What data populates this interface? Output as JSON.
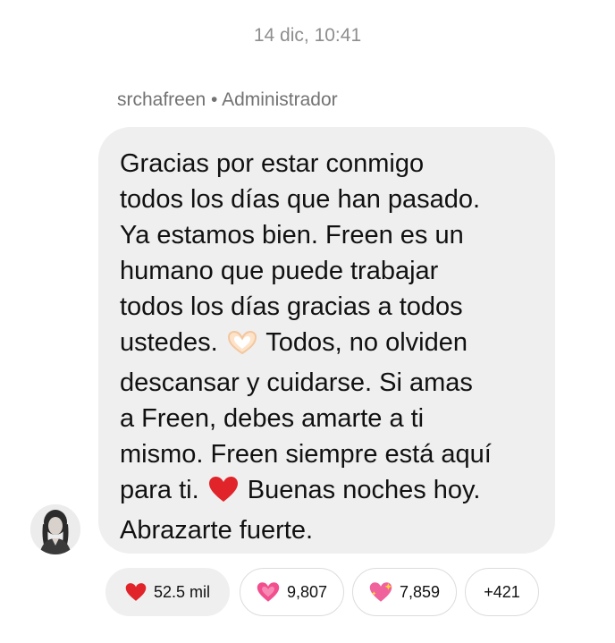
{
  "header": {
    "timestamp": "14 dic, 10:41"
  },
  "message": {
    "sender_label": "srchafreen • Administrador",
    "avatar_icon": "profile-photo-avatar",
    "lines": [
      "Gracias por estar conmigo",
      "todos los días que han pasado.",
      "Ya estamos bien. Freen es un",
      "humano que puede trabajar",
      "todos los días gracias a todos",
      "ustedes.",
      "Todos, no olviden",
      "descansar y cuidarse. Si amas",
      "a Freen, debes amarte a ti",
      "mismo. Freen siempre está aquí",
      "para ti.",
      "Buenas noches hoy.",
      "Abrazarte fuerte."
    ],
    "inline_emojis": [
      "heart-hands-icon",
      "red-heart-icon"
    ]
  },
  "reactions": [
    {
      "icon": "red-heart-icon",
      "count": "52.5 mil",
      "selected": true
    },
    {
      "icon": "pink-hearts-icon",
      "count": "9,807",
      "selected": false
    },
    {
      "icon": "sparkling-heart-icon",
      "count": "7,859",
      "selected": false
    },
    {
      "icon": "",
      "count": "+421",
      "selected": false
    }
  ],
  "colors": {
    "bubble": "#efefef",
    "timestamp_text": "#8e8e8e",
    "sender_text": "#737373",
    "heart_red": "#e0242a",
    "heart_pink": "#f24f8f"
  }
}
